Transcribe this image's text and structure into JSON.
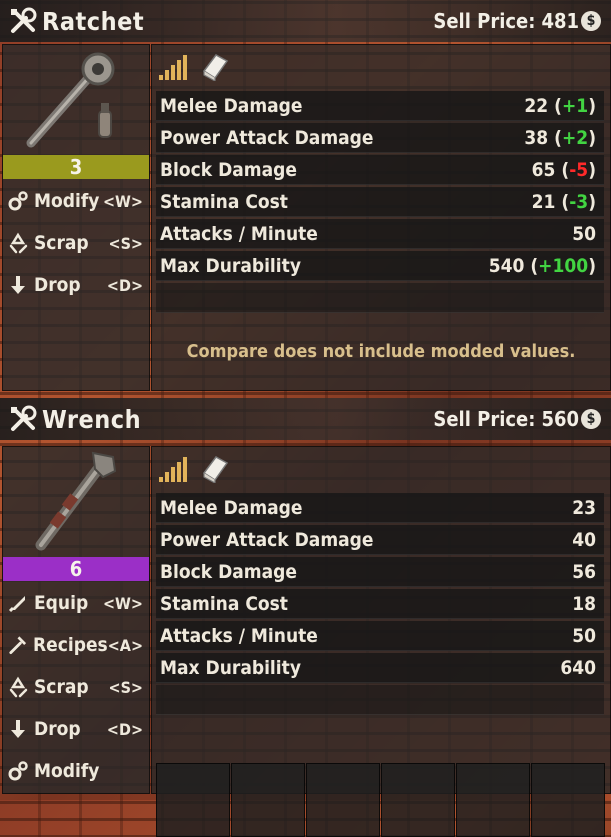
{
  "items": [
    {
      "name": "Ratchet",
      "sell_label": "Sell Price:",
      "sell_value": "481",
      "coin_symbol": "$",
      "quality": "3",
      "quality_color": "#9a9a1e",
      "actions": [
        {
          "label": "Modify",
          "key": "<W>",
          "icon": "gear-icon"
        },
        {
          "label": "Scrap",
          "key": "<S>",
          "icon": "recycle-icon"
        },
        {
          "label": "Drop",
          "key": "<D>",
          "icon": "arrow-down-icon"
        }
      ],
      "stats": [
        {
          "label": "Melee Damage",
          "value": "22",
          "delta": "+1",
          "delta_type": "pos"
        },
        {
          "label": "Power Attack Damage",
          "value": "38",
          "delta": "+2",
          "delta_type": "pos"
        },
        {
          "label": "Block Damage",
          "value": "65",
          "delta": "-5",
          "delta_type": "neg"
        },
        {
          "label": "Stamina Cost",
          "value": "21",
          "delta": "-3",
          "delta_type": "pos"
        },
        {
          "label": "Attacks / Minute",
          "value": "50",
          "delta": "",
          "delta_type": ""
        },
        {
          "label": "Max Durability",
          "value": "540",
          "delta": "+100",
          "delta_type": "pos"
        }
      ],
      "note": "Compare does not include modded values."
    },
    {
      "name": "Wrench",
      "sell_label": "Sell Price:",
      "sell_value": "560",
      "coin_symbol": "$",
      "quality": "6",
      "quality_color": "#9b2fc7",
      "actions": [
        {
          "label": "Equip",
          "key": "<W>",
          "icon": "equip-icon"
        },
        {
          "label": "Recipes",
          "key": "<A>",
          "icon": "hammer-icon"
        },
        {
          "label": "Scrap",
          "key": "<S>",
          "icon": "recycle-icon"
        },
        {
          "label": "Drop",
          "key": "<D>",
          "icon": "arrow-down-icon"
        },
        {
          "label": "Modify",
          "key": "",
          "icon": "gear-icon"
        }
      ],
      "stats": [
        {
          "label": "Melee Damage",
          "value": "23"
        },
        {
          "label": "Power Attack Damage",
          "value": "40"
        },
        {
          "label": "Block Damage",
          "value": "56"
        },
        {
          "label": "Stamina Cost",
          "value": "18"
        },
        {
          "label": "Attacks / Minute",
          "value": "50"
        },
        {
          "label": "Max Durability",
          "value": "640"
        }
      ],
      "mod_slots": 6
    }
  ],
  "colors": {
    "positive": "#42d442",
    "negative": "#ff2a2a",
    "note": "#d8bf8c",
    "tier_bars": "#e1b35a"
  }
}
